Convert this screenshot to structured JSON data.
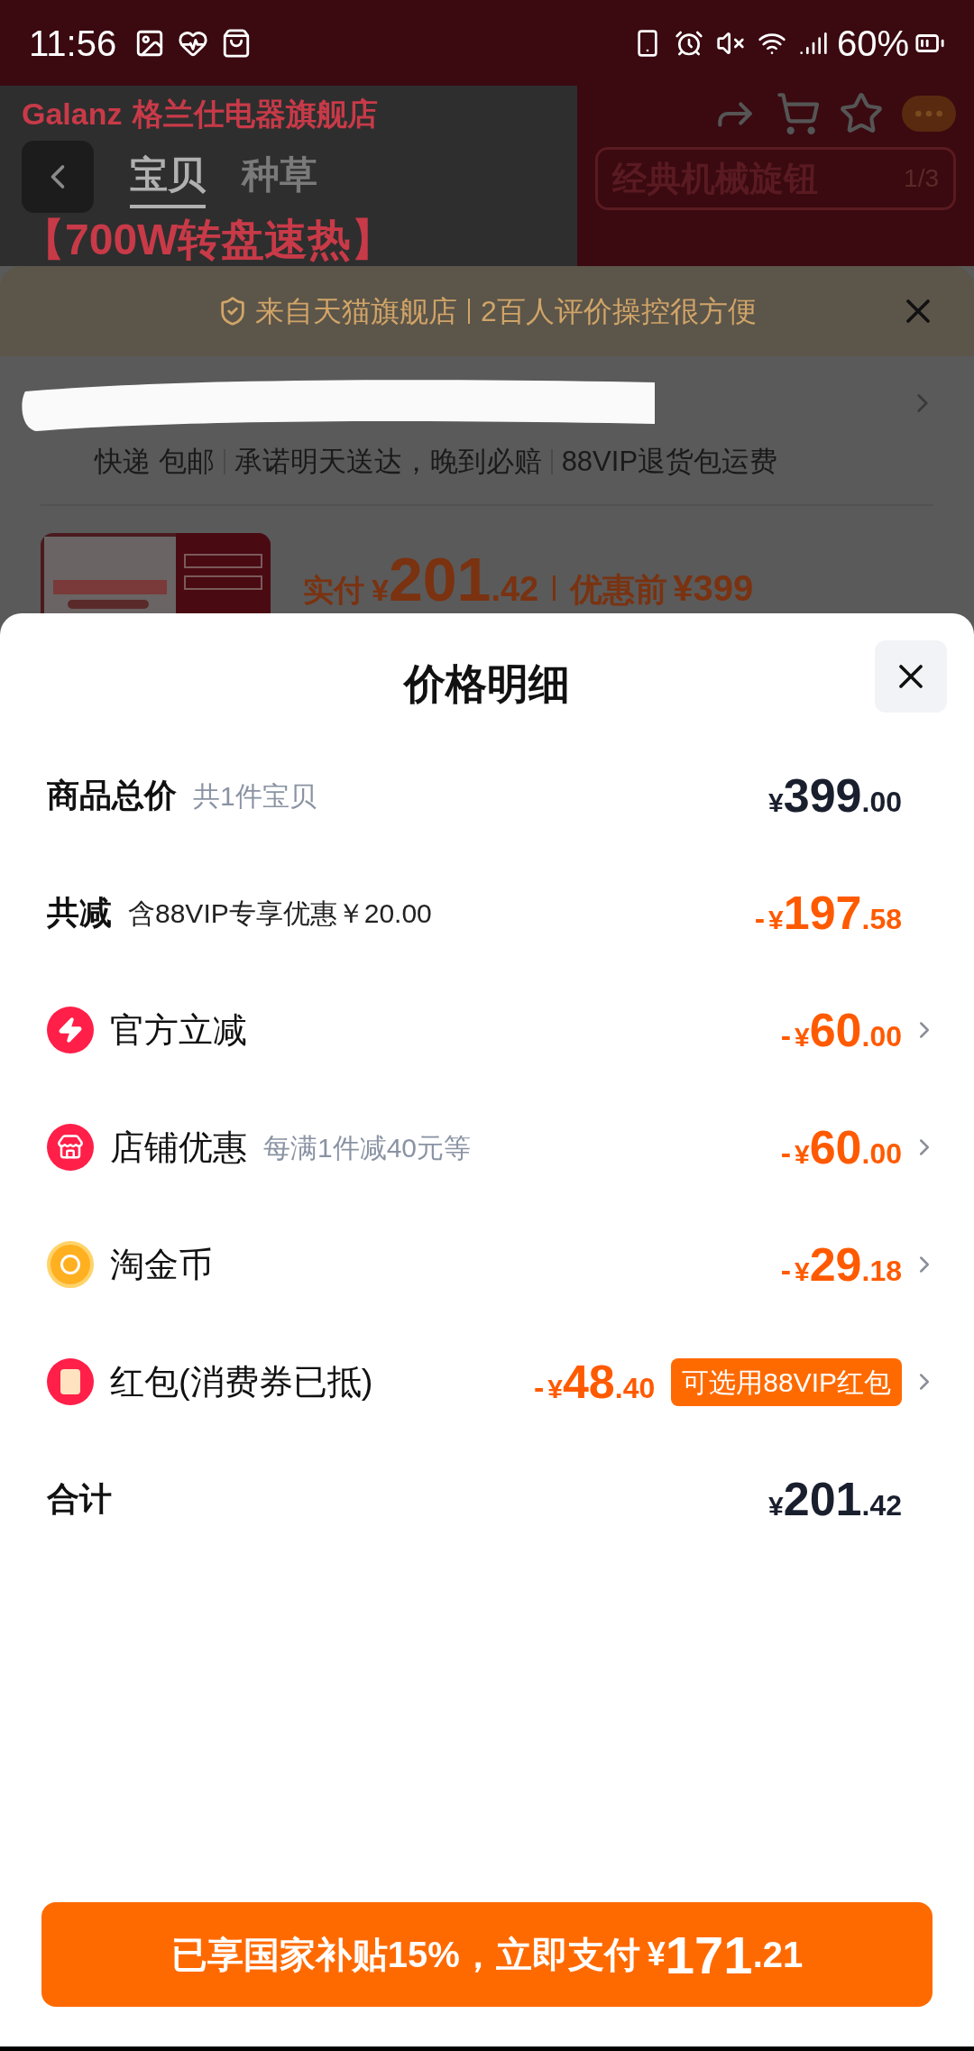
{
  "status_bar": {
    "time": "11:56",
    "battery": "60%"
  },
  "product_page": {
    "brand": "Galanz",
    "store_name": "格兰仕电器旗舰店",
    "tabs": [
      {
        "label": "宝贝",
        "selected": true
      },
      {
        "label": "种草",
        "selected": false
      }
    ],
    "banner_title": "【700W转盘速热】",
    "feature_tag": "经典机械旋钮",
    "image_counter": "1/3"
  },
  "order_sheet": {
    "notice": [
      "来自天猫旗舰店",
      "2百人评价操控很方便"
    ],
    "delivery_tags": [
      "快递 包邮",
      "承诺明天送达，晚到必赔",
      "88VIP退货包运费"
    ],
    "paid_label": "实付",
    "paid_price": {
      "currency": "¥",
      "integer": "201",
      "decimal": ".42"
    },
    "original_label": "优惠前",
    "original_price": "¥399"
  },
  "price_detail": {
    "title": "价格明细",
    "rows": [
      {
        "kind": "total",
        "label": "商品总价",
        "note": "共1件宝贝",
        "price": {
          "currency": "¥",
          "integer": "399",
          "decimal": ".00"
        },
        "expandable": false
      },
      {
        "kind": "summary",
        "label": "共减",
        "note": "含88VIP专享优惠￥20.00",
        "price": {
          "sign": "-",
          "currency": "¥",
          "integer": "197",
          "decimal": ".58"
        },
        "expandable": false
      },
      {
        "kind": "instant",
        "label": "官方立减",
        "price": {
          "sign": "-",
          "currency": "¥",
          "integer": "60",
          "decimal": ".00"
        },
        "expandable": true
      },
      {
        "kind": "shop",
        "label": "店铺优惠",
        "note": "每满1件减40元等",
        "price": {
          "sign": "-",
          "currency": "¥",
          "integer": "60",
          "decimal": ".00"
        },
        "expandable": true
      },
      {
        "kind": "coin",
        "label": "淘金币",
        "price": {
          "sign": "-",
          "currency": "¥",
          "integer": "29",
          "decimal": ".18"
        },
        "expandable": true
      },
      {
        "kind": "voucher",
        "label": "红包(消费券已抵)",
        "price": {
          "sign": "-",
          "currency": "¥",
          "integer": "48",
          "decimal": ".40"
        },
        "badge": "可选用88VIP红包",
        "expandable": true
      },
      {
        "kind": "total",
        "label": "合计",
        "price": {
          "currency": "¥",
          "integer": "201",
          "decimal": ".42"
        },
        "expandable": false
      }
    ]
  },
  "pay_button": {
    "label": "已享国家补贴15%，立即支付",
    "currency": "¥",
    "integer": "171",
    "decimal": ".21"
  }
}
